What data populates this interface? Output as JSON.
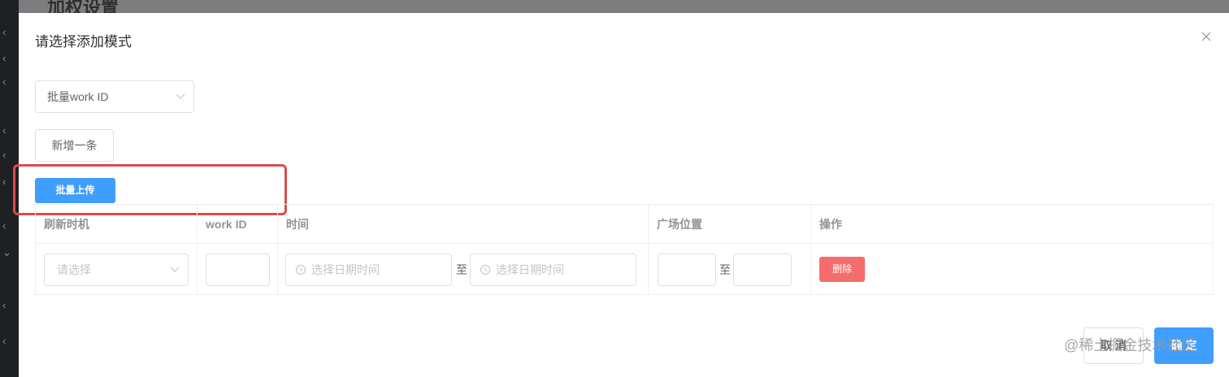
{
  "background": {
    "page_title": "加权设置"
  },
  "dialog": {
    "title": "请选择添加模式",
    "mode_select": {
      "value": "批量work ID"
    },
    "add_button": "新增一条",
    "upload_button": "批量上传",
    "table": {
      "headers": [
        "刷新时机",
        "work ID",
        "时间",
        "广场位置",
        "操作"
      ],
      "row": {
        "refresh_placeholder": "请选择",
        "workid_value": "",
        "start_time_placeholder": "选择日期时间",
        "range_separator": "至",
        "end_time_placeholder": "选择日期时间",
        "pos_separator": "至",
        "pos_from_value": "",
        "pos_to_value": "",
        "delete_button": "删除"
      }
    },
    "footer": {
      "cancel": "取 消",
      "confirm": "确 定"
    }
  },
  "watermark": "@稀土掘金技术社区",
  "colors": {
    "primary": "#409eff",
    "danger": "#f56c6c",
    "highlight": "#d94c4c"
  }
}
